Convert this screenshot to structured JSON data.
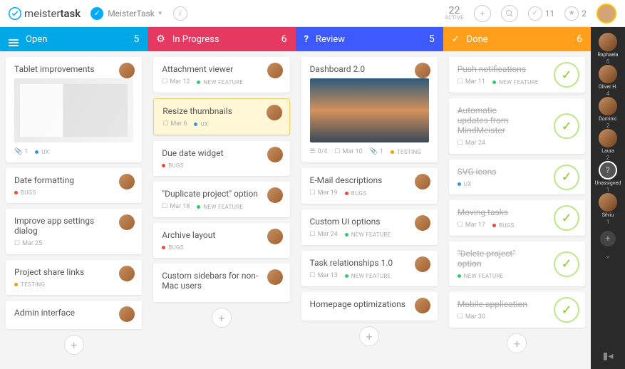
{
  "header": {
    "logo_prefix": "meister",
    "logo_suffix": "task",
    "project_name": "MeisterTask",
    "active_count": "22",
    "active_label": "ACTIVE",
    "checked_count": "11",
    "starred_count": "2"
  },
  "columns": [
    {
      "key": "open",
      "title": "Open",
      "count": "5",
      "icon": "menu"
    },
    {
      "key": "progress",
      "title": "In Progress",
      "count": "6",
      "icon": "gear"
    },
    {
      "key": "review",
      "title": "Review",
      "count": "5",
      "icon": "question"
    },
    {
      "key": "done",
      "title": "Done",
      "count": "6",
      "icon": "check"
    }
  ],
  "cards": {
    "open": [
      {
        "title": "Tablet improvements",
        "image": "tablet",
        "meta": [
          {
            "icon": "clip",
            "text": "1"
          }
        ],
        "tags": [
          "ux"
        ]
      },
      {
        "title": "Date formatting",
        "tags": [
          "bugs"
        ]
      },
      {
        "title": "Improve app settings dialog",
        "meta": [
          {
            "icon": "cal",
            "text": "Mar 25"
          }
        ]
      },
      {
        "title": "Project share links",
        "tags": [
          "testing"
        ]
      },
      {
        "title": "Admin interface"
      }
    ],
    "progress": [
      {
        "title": "Attachment viewer",
        "meta": [
          {
            "icon": "cal",
            "text": "Mar 12"
          }
        ],
        "tags": [
          "new"
        ]
      },
      {
        "title": "Resize thumbnails",
        "meta": [
          {
            "icon": "cal",
            "text": "Mar 6"
          }
        ],
        "tags": [
          "ux"
        ],
        "highlight": true
      },
      {
        "title": "Due date widget",
        "tags": [
          "bugs"
        ]
      },
      {
        "title": "\"Duplicate project\" option",
        "meta": [
          {
            "icon": "cal",
            "text": "Mar 18"
          }
        ],
        "tags": [
          "new"
        ]
      },
      {
        "title": "Archive layout",
        "tags": [
          "bugs"
        ]
      },
      {
        "title": "Custom sidebars for non-Mac users"
      }
    ],
    "review": [
      {
        "title": "Dashboard 2.0",
        "image": "dashboard",
        "meta": [
          {
            "icon": "list",
            "text": "0/4"
          },
          {
            "icon": "cal",
            "text": "Mar 10"
          },
          {
            "icon": "clip",
            "text": "1"
          }
        ],
        "tags": [
          "testing"
        ]
      },
      {
        "title": "E-Mail descriptions",
        "meta": [
          {
            "icon": "cal",
            "text": "Mar 19"
          }
        ],
        "tags": [
          "bugs"
        ]
      },
      {
        "title": "Custom UI options",
        "meta": [
          {
            "icon": "cal",
            "text": "Mar 24"
          }
        ],
        "tags": [
          "new"
        ]
      },
      {
        "title": "Task relationships 1.0",
        "meta": [
          {
            "icon": "cal",
            "text": "Mar 13"
          }
        ],
        "tags": [
          "new"
        ]
      },
      {
        "title": "Homepage optimizations"
      }
    ],
    "done": [
      {
        "title": "Push notifications",
        "meta": [
          {
            "icon": "cal",
            "text": "Mar 11"
          }
        ],
        "tags": [
          "new"
        ],
        "done": true
      },
      {
        "title": "Automatic updates from MindMeister",
        "meta": [
          {
            "icon": "cal",
            "text": "Mar 24"
          }
        ],
        "done": true
      },
      {
        "title": "SVG icons",
        "tags": [
          "ux"
        ],
        "done": true
      },
      {
        "title": "Moving tasks",
        "meta": [
          {
            "icon": "cal",
            "text": "Mar 17"
          }
        ],
        "tags": [
          "bugs"
        ],
        "done": true
      },
      {
        "title": "\"Delete project\" option",
        "tags": [
          "new"
        ],
        "done": true
      },
      {
        "title": "Mobile application",
        "meta": [
          {
            "icon": "cal",
            "text": "Mar 30"
          }
        ],
        "done": true
      }
    ]
  },
  "tag_labels": {
    "new": "NEW FEATURE",
    "bugs": "BUGS",
    "ux": "UX",
    "testing": "TESTING"
  },
  "sidebar_users": [
    {
      "name": "Raphaela",
      "count": "6"
    },
    {
      "name": "Oliver H.",
      "count": "4"
    },
    {
      "name": "Dominic",
      "count": "2"
    },
    {
      "name": "Laura",
      "count": "2"
    },
    {
      "name": "Unassigned",
      "count": "1",
      "q": true,
      "selected": true
    },
    {
      "name": "Silviu",
      "count": "1"
    }
  ]
}
